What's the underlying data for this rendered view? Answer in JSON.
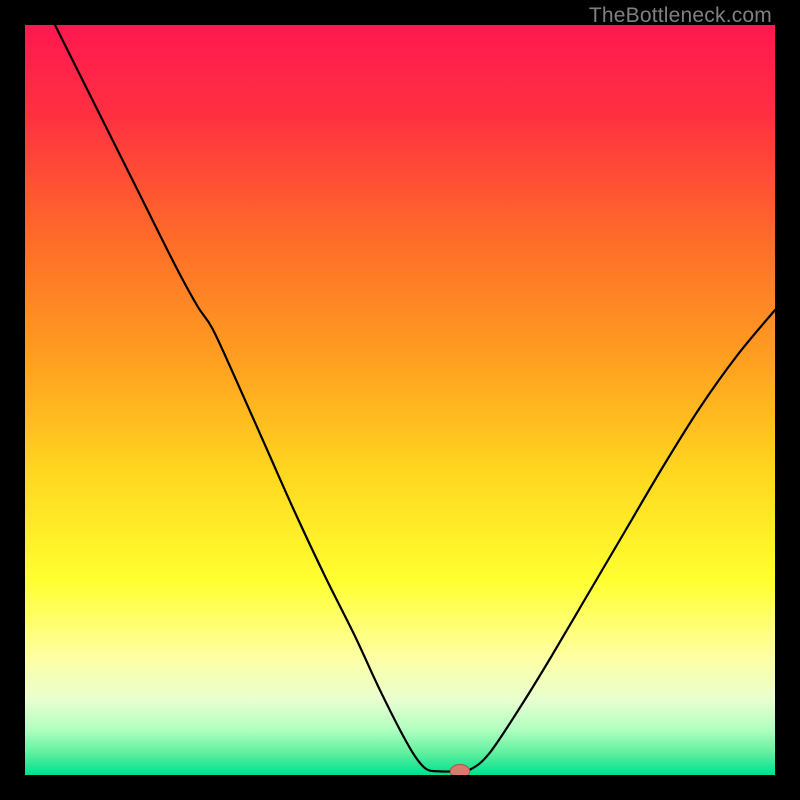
{
  "watermark": "TheBottleneck.com",
  "chart_data": {
    "type": "line",
    "title": "",
    "xlabel": "",
    "ylabel": "",
    "xlim": [
      0,
      100
    ],
    "ylim": [
      0,
      100
    ],
    "background_gradient": {
      "stops": [
        {
          "offset": 0.0,
          "color": "#ff1850"
        },
        {
          "offset": 0.12,
          "color": "#ff3040"
        },
        {
          "offset": 0.28,
          "color": "#ff6a2a"
        },
        {
          "offset": 0.45,
          "color": "#ffa020"
        },
        {
          "offset": 0.6,
          "color": "#ffd820"
        },
        {
          "offset": 0.74,
          "color": "#ffff30"
        },
        {
          "offset": 0.84,
          "color": "#ffffa0"
        },
        {
          "offset": 0.9,
          "color": "#e8ffd0"
        },
        {
          "offset": 0.94,
          "color": "#b0ffc0"
        },
        {
          "offset": 0.97,
          "color": "#60f0a0"
        },
        {
          "offset": 1.0,
          "color": "#00e090"
        }
      ]
    },
    "series": [
      {
        "name": "bottleneck-curve",
        "color": "#000000",
        "width": 2.2,
        "points": [
          {
            "x": 4.0,
            "y": 100.0
          },
          {
            "x": 9.0,
            "y": 90.0
          },
          {
            "x": 15.0,
            "y": 78.0
          },
          {
            "x": 20.0,
            "y": 68.0
          },
          {
            "x": 23.0,
            "y": 62.5
          },
          {
            "x": 25.0,
            "y": 59.5
          },
          {
            "x": 28.0,
            "y": 53.0
          },
          {
            "x": 32.0,
            "y": 44.0
          },
          {
            "x": 36.0,
            "y": 35.0
          },
          {
            "x": 40.0,
            "y": 26.5
          },
          {
            "x": 44.0,
            "y": 18.5
          },
          {
            "x": 47.0,
            "y": 12.0
          },
          {
            "x": 50.0,
            "y": 6.0
          },
          {
            "x": 52.0,
            "y": 2.5
          },
          {
            "x": 53.5,
            "y": 0.8
          },
          {
            "x": 55.0,
            "y": 0.5
          },
          {
            "x": 57.5,
            "y": 0.5
          },
          {
            "x": 59.5,
            "y": 0.8
          },
          {
            "x": 62.0,
            "y": 3.0
          },
          {
            "x": 66.0,
            "y": 9.0
          },
          {
            "x": 70.0,
            "y": 15.5
          },
          {
            "x": 75.0,
            "y": 24.0
          },
          {
            "x": 80.0,
            "y": 32.5
          },
          {
            "x": 85.0,
            "y": 41.0
          },
          {
            "x": 90.0,
            "y": 49.0
          },
          {
            "x": 95.0,
            "y": 56.0
          },
          {
            "x": 100.0,
            "y": 62.0
          }
        ]
      }
    ],
    "marker": {
      "x": 58.0,
      "y": 0.5,
      "rx": 1.3,
      "ry": 0.9,
      "fill": "#d87a6e",
      "stroke": "#b05048"
    }
  }
}
